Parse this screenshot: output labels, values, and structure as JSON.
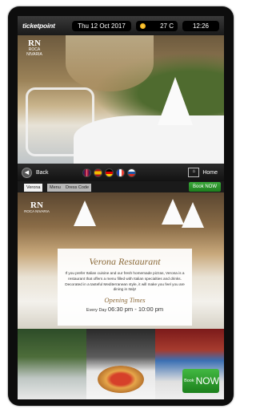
{
  "topbar": {
    "brand": "ticketpoint",
    "date": "Thu 12 Oct 2017",
    "temperature": "27 C",
    "time": "12:26"
  },
  "hero": {
    "logo_mark": "RN",
    "logo_text": "ROCA NIVARIA"
  },
  "nav": {
    "back_label": "Back",
    "home_label": "Home",
    "flags": [
      {
        "name": "gb-flag-icon",
        "color": "#c8102e"
      },
      {
        "name": "spain-flag-icon",
        "color": "#f1bf00"
      },
      {
        "name": "germany-flag-icon",
        "color": "#dd0000"
      },
      {
        "name": "france-flag-icon",
        "color": "#2146b3"
      },
      {
        "name": "russia-flag-icon",
        "color": "#1c57a5"
      }
    ]
  },
  "tabs": [
    {
      "label": "Verona"
    },
    {
      "label": "Menu"
    },
    {
      "label": "Dress Code"
    }
  ],
  "book_small_label": "Book NOW",
  "content": {
    "logo_mark": "RN",
    "logo_text": "ROCA NIVARIA",
    "title": "Verona Restaurant",
    "description": "If you prefer Italian cuisine and our fresh homemade pizzas, Verona is a restaurant that offers a menu filled with Italian specialties and drinks. Decorated in a tasteful Mediterranean style, it will make you feel you are dining in Italy!",
    "opening_title": "Opening Times",
    "opening_days": "Every Day",
    "opening_hours": "06:30 pm - 10:00 pm"
  },
  "book_big": {
    "small": "Book",
    "big": "NOW"
  },
  "colors": {
    "accent_green": "#2a952a",
    "title_gold": "#8b6a3a"
  }
}
